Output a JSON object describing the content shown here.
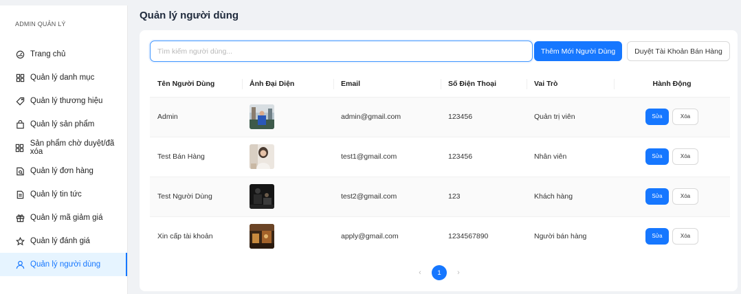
{
  "sidebar": {
    "title": "ADMIN QUẢN LÝ",
    "items": [
      {
        "label": "Trang chủ",
        "icon": "dashboard-icon"
      },
      {
        "label": "Quản lý danh mục",
        "icon": "appstore-icon"
      },
      {
        "label": "Quản lý thương hiệu",
        "icon": "tag-icon"
      },
      {
        "label": "Quản lý sản phẩm",
        "icon": "shopping-icon"
      },
      {
        "label": "Sản phẩm chờ duyệt/đã xóa",
        "icon": "appstore-icon"
      },
      {
        "label": "Quản lý đơn hàng",
        "icon": "file-search-icon"
      },
      {
        "label": "Quản lý tin tức",
        "icon": "file-text-icon"
      },
      {
        "label": "Quản lý mã giảm giá",
        "icon": "gift-icon"
      },
      {
        "label": "Quản lý đánh giá",
        "icon": "star-icon"
      },
      {
        "label": "Quản lý người dùng",
        "icon": "user-icon",
        "active": true
      }
    ]
  },
  "page": {
    "title": "Quản lý người dùng"
  },
  "toolbar": {
    "search_placeholder": "Tìm kiếm người dùng...",
    "add_label": "Thêm Mới Người Dùng",
    "approve_label": "Duyệt Tài Khoản Bán Hàng"
  },
  "table": {
    "columns": [
      "Tên Người Dùng",
      "Ảnh Đại Diện",
      "Email",
      "Số Điện Thoại",
      "Vai Trò",
      "Hành Động"
    ],
    "rows": [
      {
        "name": "Admin",
        "email": "admin@gmail.com",
        "phone": "123456",
        "role": "Quản trị viên"
      },
      {
        "name": "Test Bán Hàng",
        "email": "test1@gmail.com",
        "phone": "123456",
        "role": "Nhân viên"
      },
      {
        "name": "Test Người Dùng",
        "email": "test2@gmail.com",
        "phone": "123",
        "role": "Khách hàng"
      },
      {
        "name": "Xin cấp tài khoản",
        "email": "apply@gmail.com",
        "phone": "1234567890",
        "role": "Người bán hàng"
      }
    ],
    "edit_label": "Sửa",
    "delete_label": "Xóa"
  },
  "pagination": {
    "current": "1"
  },
  "colors": {
    "accent": "#1677ff",
    "active_bg": "#e6f4ff"
  }
}
